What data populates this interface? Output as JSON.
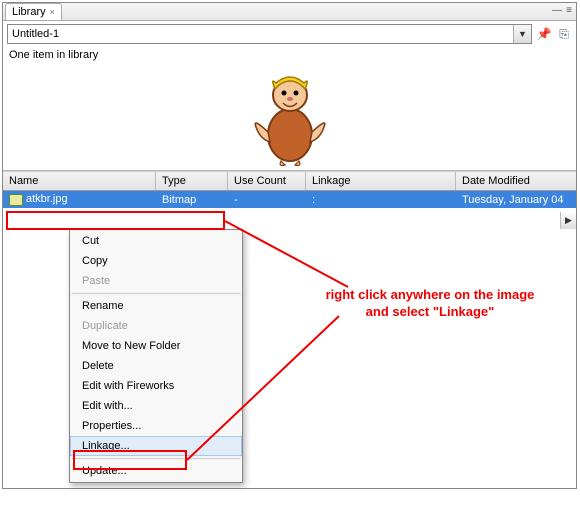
{
  "tab": {
    "label": "Library"
  },
  "document": {
    "name": "Untitled-1"
  },
  "status": {
    "count_text": "One item in library"
  },
  "columns": {
    "name": "Name",
    "type": "Type",
    "use_count": "Use Count",
    "linkage": "Linkage",
    "date_modified": "Date Modified"
  },
  "rows": [
    {
      "name": "atkbr.jpg",
      "type": "Bitmap",
      "use_count": "-",
      "linkage": ":",
      "date_modified": "Tuesday, January 04"
    }
  ],
  "context_menu": {
    "items": [
      {
        "label": "Cut",
        "disabled": false
      },
      {
        "label": "Copy",
        "disabled": false
      },
      {
        "label": "Paste",
        "disabled": true
      },
      {
        "sep": true
      },
      {
        "label": "Rename",
        "disabled": false
      },
      {
        "label": "Duplicate",
        "disabled": true
      },
      {
        "label": "Move to New Folder",
        "disabled": false
      },
      {
        "label": "Delete",
        "disabled": false
      },
      {
        "label": "Edit with Fireworks",
        "disabled": false
      },
      {
        "label": "Edit with...",
        "disabled": false
      },
      {
        "label": "Properties...",
        "disabled": false
      },
      {
        "label": "Linkage...",
        "disabled": false,
        "hover": true
      },
      {
        "sep": true
      },
      {
        "label": "Update...",
        "disabled": false
      }
    ]
  },
  "annotation": {
    "text_line1": "right click anywhere on the image",
    "text_line2": "and select \"Linkage\""
  },
  "colors": {
    "highlight": "#e00",
    "selection": "#3a84df"
  }
}
